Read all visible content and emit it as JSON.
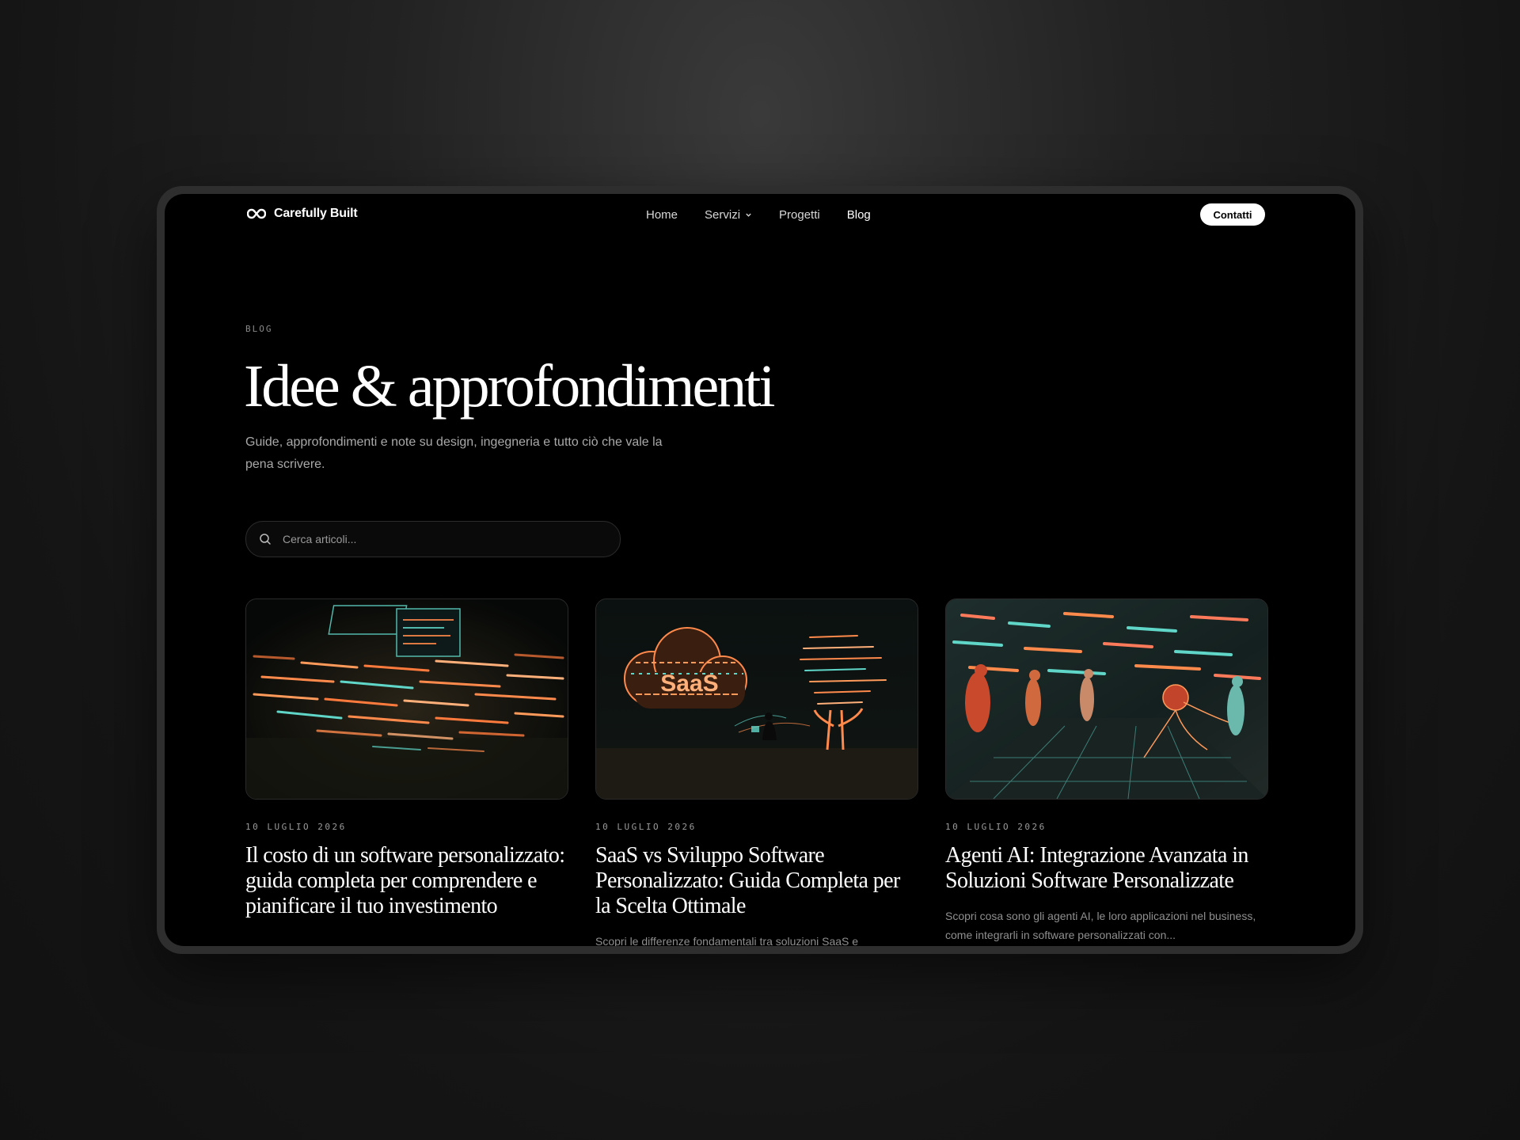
{
  "nav": {
    "brand": "Carefully Built",
    "links": [
      "Home",
      "Servizi",
      "Progetti",
      "Blog"
    ],
    "contact_label": "Contatti"
  },
  "hero": {
    "eyebrow": "BLOG",
    "title": "Idee & approfondimenti",
    "subtitle": "Guide, approfondimenti e note su design, ingegneria e tutto ciò che vale la pena scrivere."
  },
  "search": {
    "placeholder": "Cerca articoli..."
  },
  "articles": [
    {
      "date": "10 LUGLIO 2026",
      "title": "Il costo di un software personalizzato: guida completa per comprendere e pianificare il tuo investimento",
      "excerpt": ""
    },
    {
      "date": "10 LUGLIO 2026",
      "title": "SaaS vs Sviluppo Software Personalizzato: Guida Completa per la Scelta Ottimale",
      "excerpt": "Scopri le differenze fondamentali tra soluzioni SaaS e",
      "image_text": "SaaS"
    },
    {
      "date": "10 LUGLIO 2026",
      "title": "Agenti AI: Integrazione Avanzata in Soluzioni Software Personalizzate",
      "excerpt": "Scopri cosa sono gli agenti AI, le loro applicazioni nel business, come integrarli in software personalizzati con..."
    }
  ]
}
